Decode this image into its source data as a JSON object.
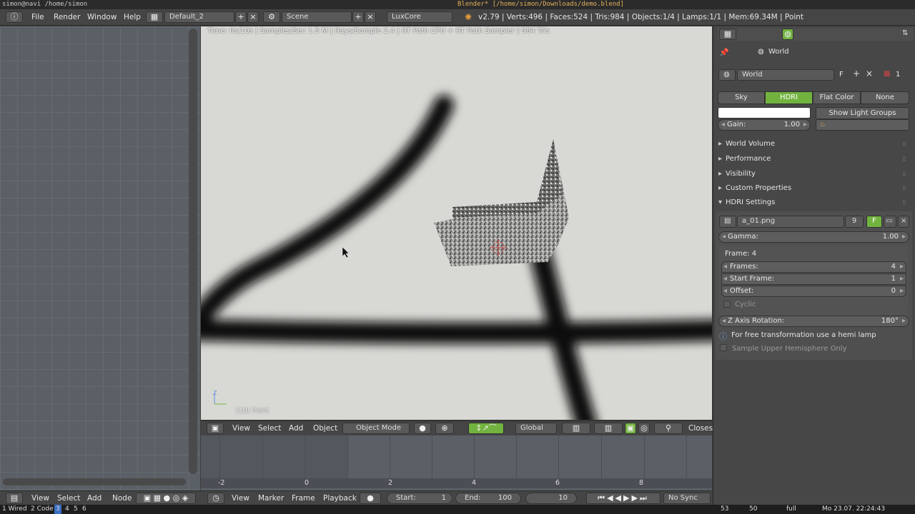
{
  "system_bar": {
    "left": "simon@navi /home/simon",
    "title": "Blender* [/home/simon/Downloads/demo.blend]"
  },
  "info_header": {
    "menus": [
      "File",
      "Render",
      "Window",
      "Help"
    ],
    "screen_layout": "Default_2",
    "scene": "Scene",
    "render_engine": "LuxCore",
    "stats": "v2.79 | Verts:496 | Faces:524 | Tris:984 | Objects:1/4 | Lamps:1/1 | Mem:69.34M | Point"
  },
  "viewport": {
    "status_text": "Time: 0s/10s | Samples/Sec 1.5 M | Rays/Sample 2.4 | RT Path CPU + RT Path Sampler | 984 Tris",
    "frame_label": "(10) Point",
    "axis_z": "Z",
    "header": {
      "menus": [
        "View",
        "Select",
        "Add",
        "Object"
      ],
      "mode": "Object Mode",
      "orientation": "Global",
      "snap": "Closest"
    }
  },
  "timeline": {
    "ticks": [
      "-2",
      "0",
      "2",
      "4",
      "6",
      "8"
    ],
    "menus": [
      "View",
      "Marker",
      "Frame",
      "Playback"
    ],
    "start_label": "Start:",
    "start_value": "1",
    "end_label": "End:",
    "end_value": "100",
    "current_frame": "10",
    "sync": "No Sync"
  },
  "node_header": {
    "menus": [
      "View",
      "Select",
      "Add",
      "Node"
    ]
  },
  "taskbar": {
    "workspaces": [
      "1 Wired",
      "2 Code",
      "3",
      "4",
      "5",
      "6"
    ],
    "active_index": 2,
    "right": [
      "53",
      "50",
      "full",
      "Mo 23.07. 22:24:43"
    ]
  },
  "properties": {
    "breadcrumb": "World",
    "world_name": "World",
    "fake_user": "F",
    "users": "1",
    "tabs": [
      "Sky",
      "HDRI",
      "Flat Color",
      "None"
    ],
    "active_tab": "HDRI",
    "show_light_groups": "Show Light Groups",
    "gain_label": "Gain:",
    "gain_value": "1.00",
    "sections": [
      "World Volume",
      "Performance",
      "Visibility",
      "Custom Properties",
      "HDRI Settings"
    ],
    "hdri": {
      "image": "a_01.png",
      "image_users": "9",
      "fake": "F",
      "gamma_label": "Gamma:",
      "gamma_value": "1.00",
      "frame_label": "Frame: 4",
      "frames_label": "Frames:",
      "frames_value": "4",
      "start_frame_label": "Start Frame:",
      "start_frame_value": "1",
      "offset_label": "Offset:",
      "offset_value": "0",
      "cyclic_label": "Cyclic",
      "zrot_label": "Z Axis Rotation:",
      "zrot_value": "180°",
      "info_text": "For free transformation use a hemi lamp",
      "upper_hemi_label": "Sample Upper Hemisphere Only"
    },
    "colors": {
      "active_green": "#72b33f",
      "panel_bg": "#474747",
      "white_swatch": "#ffffff"
    }
  }
}
